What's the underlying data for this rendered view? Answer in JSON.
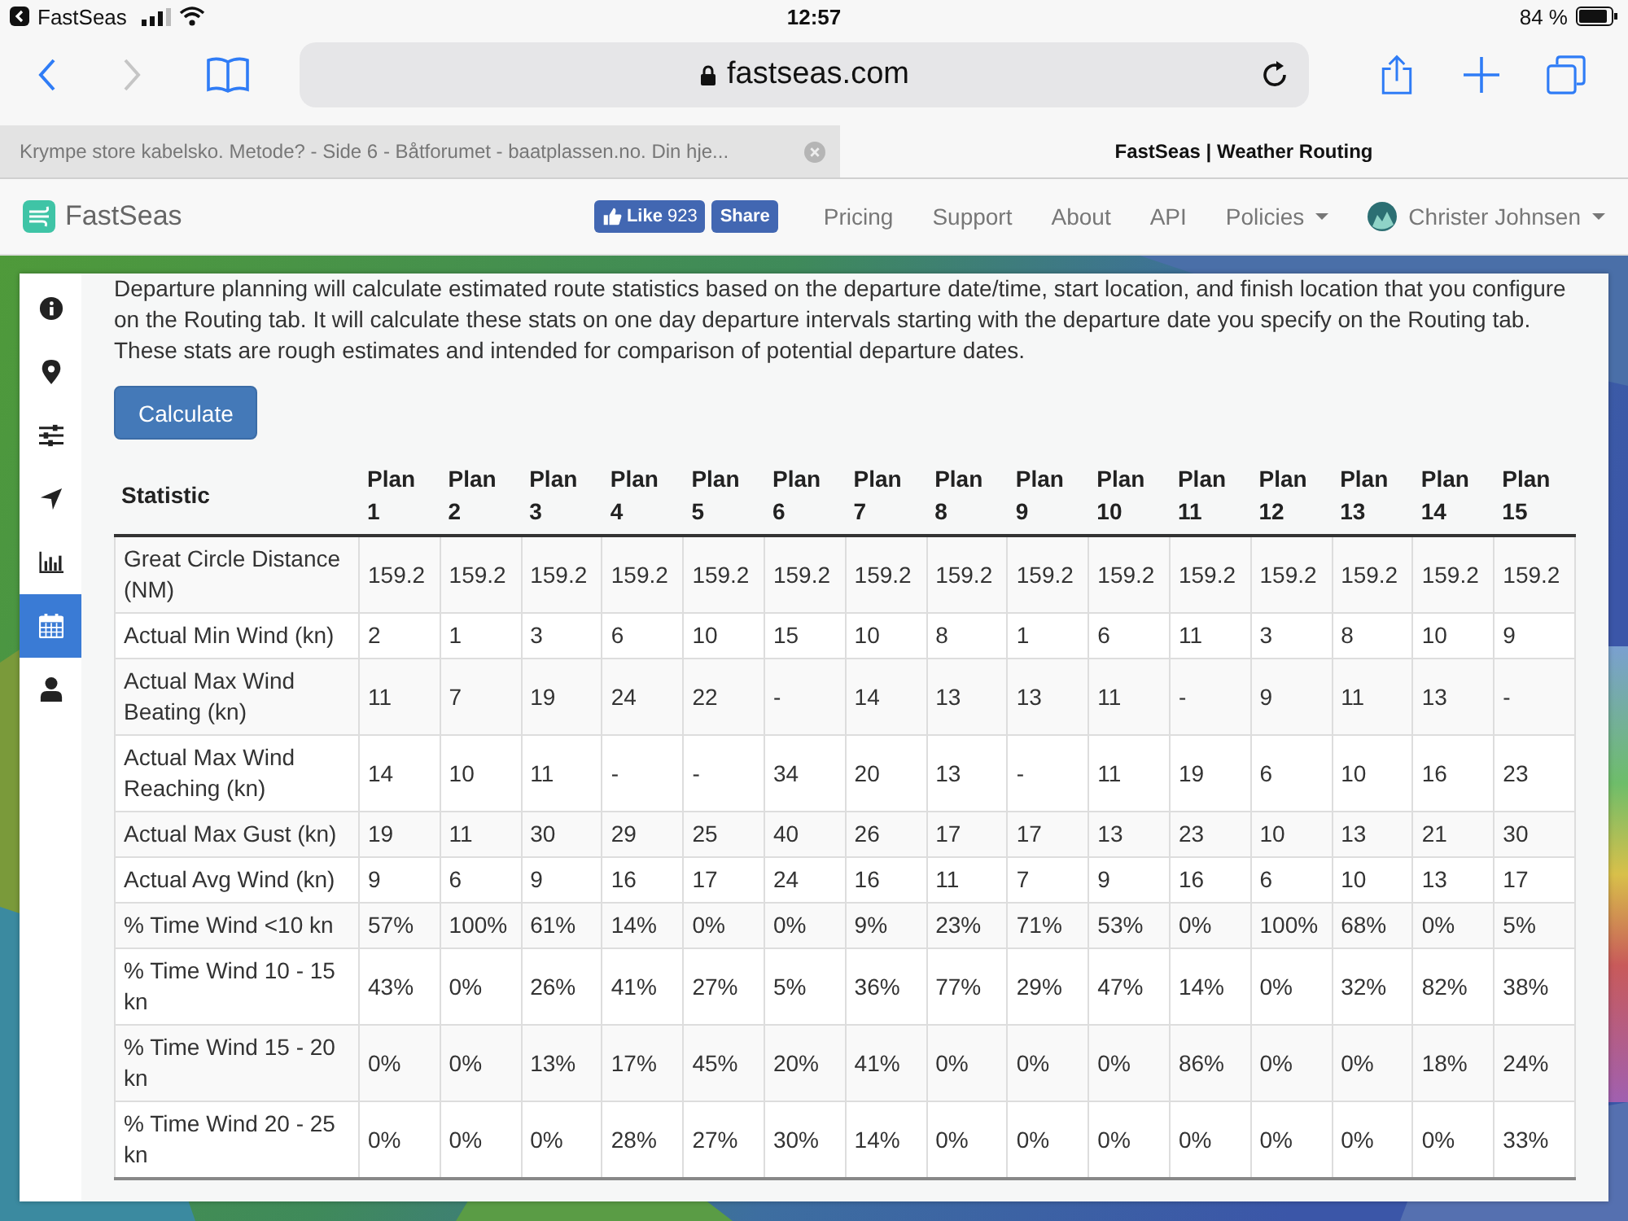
{
  "status_bar": {
    "back_app": "FastSeas",
    "time": "12:57",
    "battery": "84 %"
  },
  "browser": {
    "url": "fastseas.com",
    "forward_disabled": true
  },
  "tabs": [
    {
      "title": "Krympe store kabelsko. Metode? - Side 6 - Båtforumet - baatplassen.no. Din hje...",
      "selected": false
    },
    {
      "title": "FastSeas | Weather Routing",
      "selected": true
    }
  ],
  "navbar": {
    "brand": "FastSeas",
    "like": {
      "label": "Like",
      "count": "923"
    },
    "share": "Share",
    "links": [
      {
        "label": "Pricing",
        "dropdown": false
      },
      {
        "label": "Support",
        "dropdown": false
      },
      {
        "label": "About",
        "dropdown": false
      },
      {
        "label": "API",
        "dropdown": false
      },
      {
        "label": "Policies",
        "dropdown": true
      }
    ],
    "user": {
      "name": "Christer Johnsen",
      "dropdown": true
    }
  },
  "sidebar": {
    "items": [
      {
        "kind": "info",
        "selected": false
      },
      {
        "kind": "pin",
        "selected": false
      },
      {
        "kind": "sliders",
        "selected": false
      },
      {
        "kind": "navigate",
        "selected": false
      },
      {
        "kind": "chart",
        "selected": false
      },
      {
        "kind": "calendar",
        "selected": true
      },
      {
        "kind": "user",
        "selected": false
      }
    ]
  },
  "intro": "Departure planning will calculate estimated route statistics based on the departure date/time, start location, and finish location that you configure on the Routing tab. It will calculate these stats on one day departure intervals starting with the departure date you specify on the Routing tab. These stats are rough estimates and intended for comparison of potential departure dates.",
  "button": "Calculate",
  "table": {
    "columns": [
      "Statistic",
      "Plan 1",
      "Plan 2",
      "Plan 3",
      "Plan 4",
      "Plan 5",
      "Plan 6",
      "Plan 7",
      "Plan 8",
      "Plan 9",
      "Plan 10",
      "Plan 11",
      "Plan 12",
      "Plan 13",
      "Plan 14",
      "Plan 15"
    ],
    "rows": [
      {
        "statistic": "Great Circle Distance (NM)",
        "values": [
          "159.2",
          "159.2",
          "159.2",
          "159.2",
          "159.2",
          "159.2",
          "159.2",
          "159.2",
          "159.2",
          "159.2",
          "159.2",
          "159.2",
          "159.2",
          "159.2",
          "159.2"
        ]
      },
      {
        "statistic": "Actual Min Wind (kn)",
        "values": [
          "2",
          "1",
          "3",
          "6",
          "10",
          "15",
          "10",
          "8",
          "1",
          "6",
          "11",
          "3",
          "8",
          "10",
          "9"
        ]
      },
      {
        "statistic": "Actual Max Wind Beating (kn)",
        "values": [
          "11",
          "7",
          "19",
          "24",
          "22",
          "-",
          "14",
          "13",
          "13",
          "11",
          "-",
          "9",
          "11",
          "13",
          "-"
        ]
      },
      {
        "statistic": "Actual Max Wind Reaching (kn)",
        "values": [
          "14",
          "10",
          "11",
          "-",
          "-",
          "34",
          "20",
          "13",
          "-",
          "11",
          "19",
          "6",
          "10",
          "16",
          "23"
        ]
      },
      {
        "statistic": "Actual Max Gust (kn)",
        "values": [
          "19",
          "11",
          "30",
          "29",
          "25",
          "40",
          "26",
          "17",
          "17",
          "13",
          "23",
          "10",
          "13",
          "21",
          "30"
        ]
      },
      {
        "statistic": "Actual Avg Wind (kn)",
        "values": [
          "9",
          "6",
          "9",
          "16",
          "17",
          "24",
          "16",
          "11",
          "7",
          "9",
          "16",
          "6",
          "10",
          "13",
          "17"
        ]
      },
      {
        "statistic": "% Time Wind <10 kn",
        "values": [
          "57%",
          "100%",
          "61%",
          "14%",
          "0%",
          "0%",
          "9%",
          "23%",
          "71%",
          "53%",
          "0%",
          "100%",
          "68%",
          "0%",
          "5%"
        ]
      },
      {
        "statistic": "% Time Wind 10 - 15 kn",
        "values": [
          "43%",
          "0%",
          "26%",
          "41%",
          "27%",
          "5%",
          "36%",
          "77%",
          "29%",
          "47%",
          "14%",
          "0%",
          "32%",
          "82%",
          "38%"
        ]
      },
      {
        "statistic": "% Time Wind 15 - 20 kn",
        "values": [
          "0%",
          "0%",
          "13%",
          "17%",
          "45%",
          "20%",
          "41%",
          "0%",
          "0%",
          "0%",
          "86%",
          "0%",
          "0%",
          "18%",
          "24%"
        ]
      },
      {
        "statistic": "% Time Wind 20 - 25 kn",
        "values": [
          "0%",
          "0%",
          "0%",
          "28%",
          "27%",
          "30%",
          "14%",
          "0%",
          "0%",
          "0%",
          "0%",
          "0%",
          "0%",
          "0%",
          "33%"
        ]
      }
    ]
  }
}
